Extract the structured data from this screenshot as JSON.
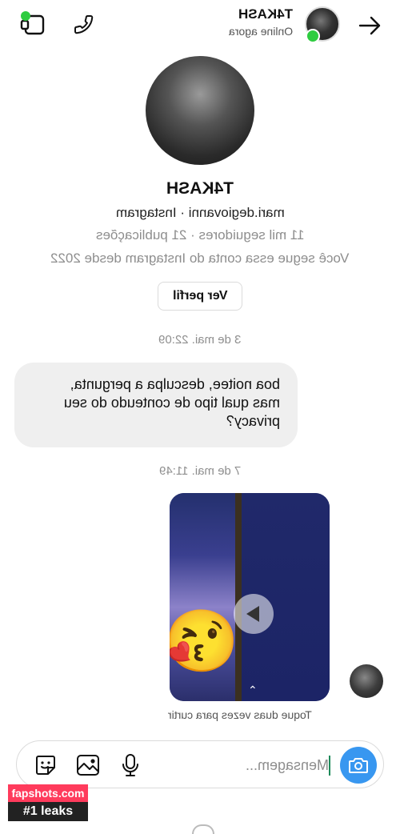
{
  "header": {
    "username": "T4KASH",
    "status": "Online agora"
  },
  "profile": {
    "name": "T4KASH",
    "handle_line": "mari.degiovanni · Instagram",
    "stats_line": "11 mil seguidores · 21 publicações",
    "follow_note": "Você segue essa conta do Instagram desde 2022",
    "view_profile_label": "Ver perfil"
  },
  "messages": [
    {
      "timestamp": "3 de mai. 22:09",
      "text_lines": [
        "boa noitee, desculpa a pergunta,",
        "mas qual tipo de conteudo do seu",
        "privacy?"
      ]
    },
    {
      "timestamp": "7 de mai. 11:49",
      "reaction_emoji": "😘"
    }
  ],
  "video_hint": "Toque duas vezes para curtir",
  "composer": {
    "placeholder": "Mensagem..."
  },
  "watermark": {
    "site": "fapshots.com",
    "tagline": "#1 leaks"
  },
  "colors": {
    "online_dot": "#2ecc40",
    "camera_button": "#3897f0",
    "bubble": "#efefef",
    "meta_text": "#8e8e8e"
  },
  "icons": [
    "video-call-icon",
    "phone-icon",
    "back-arrow-icon",
    "sticker-icon",
    "gallery-icon",
    "mic-icon",
    "camera-icon",
    "play-icon"
  ]
}
